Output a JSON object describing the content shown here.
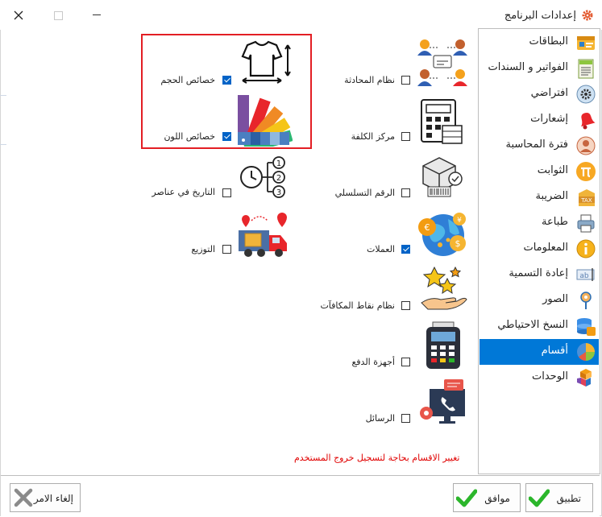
{
  "window": {
    "title": "إعدادات البرنامج",
    "title_icon": "gear-icon"
  },
  "sidebar": {
    "items": [
      {
        "label": "البطاقات",
        "icon": "cards-icon",
        "active": false
      },
      {
        "label": "الفواتير و السندات",
        "icon": "bills-icon",
        "active": false
      },
      {
        "label": "افتراضي",
        "icon": "default-gear-icon",
        "active": false
      },
      {
        "label": "إشعارات",
        "icon": "bell-icon",
        "active": false
      },
      {
        "label": "فترة المحاسبة",
        "icon": "accounting-period-icon",
        "active": false
      },
      {
        "label": "الثوابت",
        "icon": "pi-icon",
        "active": false
      },
      {
        "label": "الضريبة",
        "icon": "tax-icon",
        "active": false
      },
      {
        "label": "طباعة",
        "icon": "printer-icon",
        "active": false
      },
      {
        "label": "المعلومات",
        "icon": "info-icon",
        "active": false
      },
      {
        "label": "إعادة التسمية",
        "icon": "rename-icon",
        "active": false
      },
      {
        "label": "الصور",
        "icon": "image-icon",
        "active": false
      },
      {
        "label": "النسخ الاحتياطي",
        "icon": "backup-icon",
        "active": false
      },
      {
        "label": "أقسام",
        "icon": "sections-pie-icon",
        "active": true
      },
      {
        "label": "الوحدات",
        "icon": "units-cubes-icon",
        "active": false
      }
    ]
  },
  "features": {
    "chat_system": {
      "label": "نظام المحادثة",
      "checked": false,
      "icon": "chat-people-icon"
    },
    "cost_center": {
      "label": "مركز الكلفة",
      "checked": false,
      "icon": "calculator-icon"
    },
    "serial_number": {
      "label": "الرقم التسلسلي",
      "checked": false,
      "icon": "barcode-box-icon"
    },
    "currencies": {
      "label": "العملات",
      "checked": true,
      "icon": "globe-currency-icon"
    },
    "rewards": {
      "label": "نظام نقاط المكافآت",
      "checked": false,
      "icon": "stars-hand-icon"
    },
    "payment_devices": {
      "label": "أجهزة الدفع",
      "checked": false,
      "icon": "pos-terminal-icon"
    },
    "messages": {
      "label": "الرسائل",
      "checked": false,
      "icon": "monitor-phone-icon"
    },
    "size_props": {
      "label": "خصائص الحجم",
      "checked": true,
      "icon": "tshirt-size-icon"
    },
    "color_props": {
      "label": "خصائص اللون",
      "checked": true,
      "icon": "color-fan-icon"
    },
    "date_in_items": {
      "label": "التاريخ في عناصر",
      "checked": false,
      "icon": "clock-steps-icon"
    },
    "distribution": {
      "label": "التوزيع",
      "checked": false,
      "icon": "delivery-truck-icon"
    }
  },
  "note": "تغيير الاقسام بحاجة لتسجيل خروج المستخدم",
  "buttons": {
    "apply": "تطبيق",
    "ok": "موافق",
    "cancel": "إلغاء الامر"
  },
  "colors": {
    "accent": "#0078d7",
    "highlight": "#e31e24",
    "note": "#e00000",
    "check": "#2bb62b",
    "cancel_x": "#8a8a8a"
  }
}
